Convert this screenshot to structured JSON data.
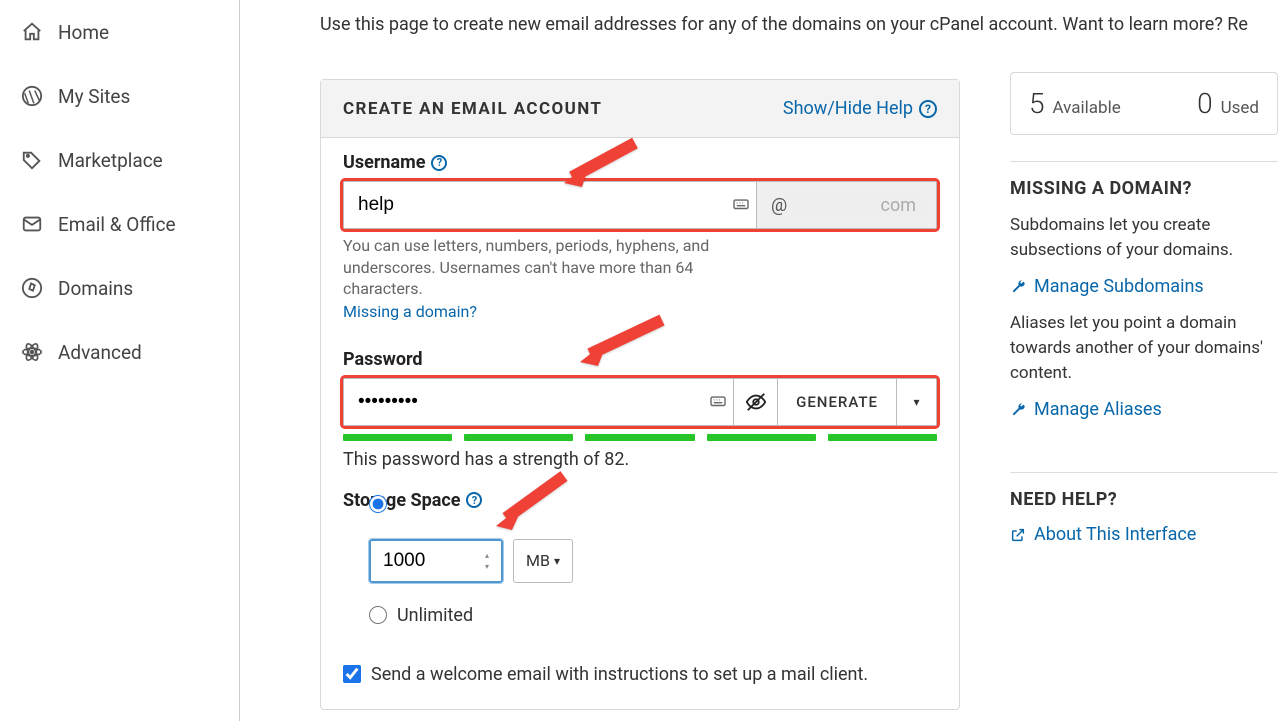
{
  "sidebar": {
    "items": [
      {
        "label": "Home",
        "icon": "home"
      },
      {
        "label": "My Sites",
        "icon": "wordpress"
      },
      {
        "label": "Marketplace",
        "icon": "tag"
      },
      {
        "label": "Email & Office",
        "icon": "mail"
      },
      {
        "label": "Domains",
        "icon": "compass"
      },
      {
        "label": "Advanced",
        "icon": "atom"
      }
    ]
  },
  "intro": "Use this page to create new email addresses for any of the domains on your cPanel account. Want to learn more? Re",
  "panel": {
    "title": "CREATE AN EMAIL ACCOUNT",
    "help_link": "Show/Hide Help",
    "username": {
      "label": "Username",
      "value": "help",
      "at": "@",
      "domain": "com",
      "hint": "You can use letters, numbers, periods, hyphens, and underscores. Usernames can't have more than 64 characters.",
      "missing_link": "Missing a domain?"
    },
    "password": {
      "label": "Password",
      "value": "•••••••••",
      "generate": "GENERATE",
      "strength_text": "This password has a strength of 82."
    },
    "storage": {
      "label": "Storage Space",
      "value": "1000",
      "unit": "MB",
      "unlimited": "Unlimited"
    },
    "welcome": {
      "text": "Send a welcome email with instructions to set up a mail client."
    }
  },
  "right": {
    "stats": {
      "available_num": "5",
      "available_lbl": "Available",
      "used_num": "0",
      "used_lbl": "Used"
    },
    "missing": {
      "head": "MISSING A DOMAIN?",
      "sub_text": "Subdomains let you create subsections of your domains.",
      "sub_link": "Manage Subdomains",
      "alias_text": "Aliases let you point a domain towards another of your domains' content.",
      "alias_link": "Manage Aliases"
    },
    "help": {
      "head": "NEED HELP?",
      "link": "About This Interface"
    }
  }
}
